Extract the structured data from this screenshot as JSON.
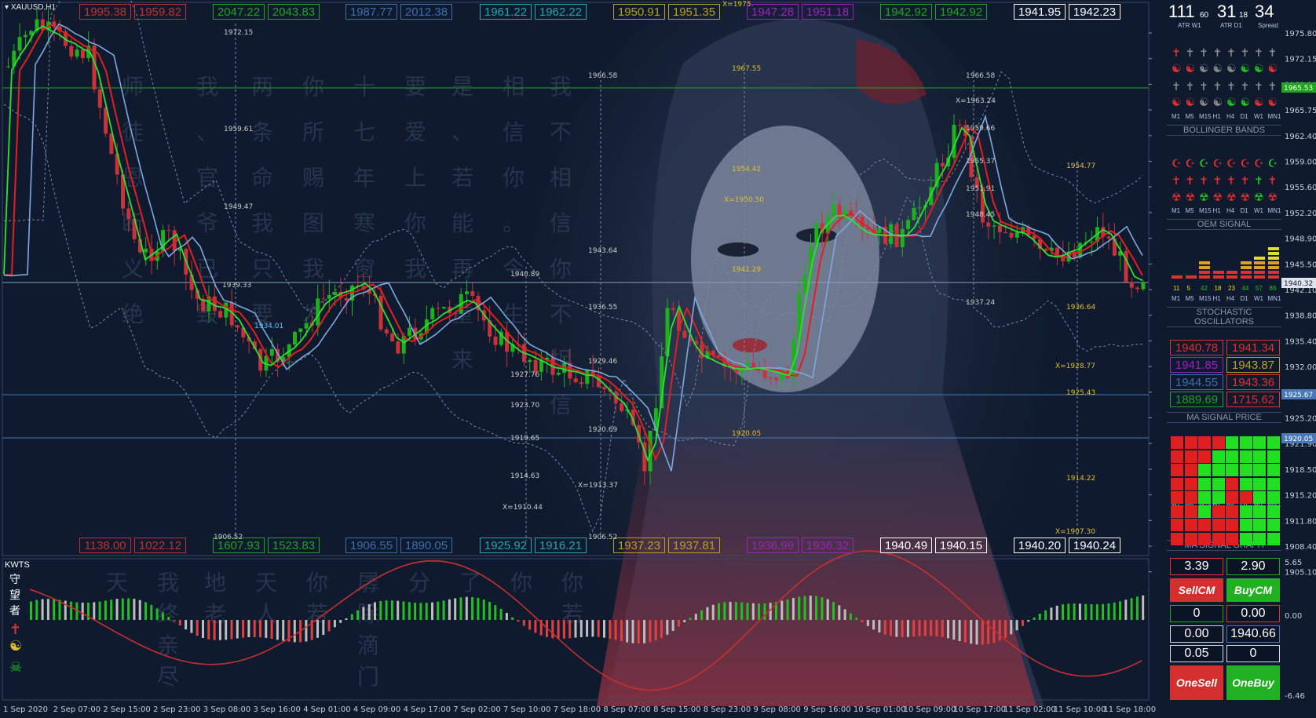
{
  "symbol": "XAUUSD,H1",
  "indicator_name": "KWTS",
  "indicator_cn": [
    "守",
    "望",
    "者"
  ],
  "top_pairs": [
    {
      "a": "1995.38",
      "b": "1959.82",
      "color": "#c0312b"
    },
    {
      "a": "2047.22",
      "b": "2043.83",
      "color": "#21a421"
    },
    {
      "a": "1987.77",
      "b": "2012.38",
      "color": "#3a6fb0"
    },
    {
      "a": "1961.22",
      "b": "1962.22",
      "color": "#20a8b0"
    },
    {
      "a": "1950.91",
      "b": "1951.35",
      "color": "#b8a020"
    },
    {
      "a": "1947.28",
      "b": "1951.18",
      "color": "#a020c0"
    },
    {
      "a": "1942.92",
      "b": "1942.92",
      "color": "#21a421"
    },
    {
      "a": "1941.95",
      "b": "1942.23",
      "color": "#ffffff"
    }
  ],
  "bottom_pairs": [
    {
      "a": "1138.00",
      "b": "1022.12",
      "color": "#c0312b"
    },
    {
      "a": "1607.93",
      "b": "1523.83",
      "color": "#21a421"
    },
    {
      "a": "1906.55",
      "b": "1890.05",
      "color": "#3a6fb0"
    },
    {
      "a": "1925.92",
      "b": "1916.21",
      "color": "#20a8b0"
    },
    {
      "a": "1937.23",
      "b": "1937.81",
      "color": "#b8a020"
    },
    {
      "a": "1936.99",
      "b": "1936.32",
      "color": "#a020c0"
    },
    {
      "a": "1940.49",
      "b": "1940.15",
      "color": "#ffffff"
    },
    {
      "a": "1940.20",
      "b": "1940.24",
      "color": "#ffffff"
    }
  ],
  "info": {
    "atr_w1": "111",
    "atr_w1_small": "60",
    "atr_d1": "31",
    "atr_d1_small": "18",
    "spread": "34",
    "lbl_atr_w1": "ATR W1",
    "lbl_atr_d1": "ATR D1",
    "lbl_spread": "Spread"
  },
  "timeframes": [
    "M1",
    "M5",
    "M15",
    "H1",
    "H4",
    "D1",
    "W1",
    "MN1"
  ],
  "panels": {
    "bollinger": "BOLLINGER BANDS",
    "oem": "OEM   SIGNAL",
    "stochastic": "STOCHASTIC OSCILLATORS",
    "ma_price": "MA SIGNAL PRICE",
    "ma_graph": "MA SIGNAL GRAPH"
  },
  "stoch_values": [
    "11",
    "5",
    "42",
    "18",
    "23",
    "44",
    "57",
    "86"
  ],
  "ma_prices": [
    {
      "v": "1940.78",
      "c": "#e03030"
    },
    {
      "v": "1941.34",
      "c": "#e03030"
    },
    {
      "v": "1941.85",
      "c": "#a020c0"
    },
    {
      "v": "1943.87",
      "c": "#b8a020"
    },
    {
      "v": "1944.55",
      "c": "#3a6fb0"
    },
    {
      "v": "1943.36",
      "c": "#e03030"
    },
    {
      "v": "1889.69",
      "c": "#21a421"
    },
    {
      "v": "1715.62",
      "c": "#e03030"
    }
  ],
  "trade": {
    "sell_val": "3.39",
    "buy_val": "2.90",
    "sell_cm": "SellCM",
    "buy_cm": "BuyCM",
    "f1": "0",
    "f2": "0.00",
    "f3": "0.00",
    "f4": "1940.66",
    "f5": "0.05",
    "f6": "0",
    "one_sell": "OneSell",
    "one_buy": "OneBuy"
  },
  "price_axis": [
    "1975.80",
    "1972.15",
    "1969.10",
    "1965.75",
    "1962.40",
    "1959.00",
    "1955.60",
    "1952.20",
    "1948.90",
    "1945.50",
    "1942.10",
    "1938.80",
    "1935.40",
    "1932.00",
    "1928.60",
    "1925.20",
    "1921.90",
    "1918.50",
    "1915.20",
    "1911.80",
    "1908.40",
    "1905.10"
  ],
  "price_tags": {
    "green": "1965.53",
    "current": "1940.32",
    "blue1": "1925.67",
    "blue2": "1920.05"
  },
  "osc_axis": {
    "top": "5.65",
    "mid": "0.00",
    "bot": "-6.46"
  },
  "time_axis": [
    "1 Sep 2020",
    "2 Sep 07:00",
    "2 Sep 15:00",
    "2 Sep 23:00",
    "3 Sep 08:00",
    "3 Sep 16:00",
    "4 Sep 01:00",
    "4 Sep 09:00",
    "4 Sep 17:00",
    "7 Sep 02:00",
    "7 Sep 10:00",
    "7 Sep 18:00",
    "8 Sep 07:00",
    "8 Sep 15:00",
    "8 Sep 23:00",
    "9 Sep 08:00",
    "9 Sep 16:00",
    "10 Sep 01:00",
    "10 Sep 09:00",
    "10 Sep 17:00",
    "11 Sep 02:00",
    "11 Sep 10:00",
    "11 Sep 18:00"
  ],
  "chart_labels": [
    {
      "t": "1972.15",
      "c": "#cccccc"
    },
    {
      "t": "1959.61",
      "c": "#cccccc"
    },
    {
      "t": "1949.47",
      "c": "#cccccc"
    },
    {
      "t": "1939.33",
      "c": "#cccccc"
    },
    {
      "t": "1934.01",
      "c": "#60c0ff"
    },
    {
      "t": "1906.52",
      "c": "#cccccc"
    },
    {
      "t": "1966.58",
      "c": "#cccccc"
    },
    {
      "t": "1943.64",
      "c": "#cccccc"
    },
    {
      "t": "1936.55",
      "c": "#cccccc"
    },
    {
      "t": "1940.89",
      "c": "#cccccc"
    },
    {
      "t": "1929.46",
      "c": "#cccccc"
    },
    {
      "t": "1927.76",
      "c": "#cccccc"
    },
    {
      "t": "1923.70",
      "c": "#cccccc"
    },
    {
      "t": "1920.69",
      "c": "#cccccc"
    },
    {
      "t": "1919.65",
      "c": "#cccccc"
    },
    {
      "t": "1914.63",
      "c": "#cccccc"
    },
    {
      "t": "X=1913.37",
      "c": "#cccccc"
    },
    {
      "t": "X=1910.44",
      "c": "#cccccc"
    },
    {
      "t": "1906.52",
      "c": "#cccccc"
    },
    {
      "t": "1967.55",
      "c": "#e0c030"
    },
    {
      "t": "1954.42",
      "c": "#e0c030"
    },
    {
      "t": "X=1950.50",
      "c": "#e0c030"
    },
    {
      "t": "1941.29",
      "c": "#e0c030"
    },
    {
      "t": "1920.05",
      "c": "#e0c030"
    },
    {
      "t": "X=1975.",
      "c": "#e0c030"
    },
    {
      "t": "1966.58",
      "c": "#cccccc"
    },
    {
      "t": "X=1963.24",
      "c": "#cccccc"
    },
    {
      "t": "1959.66",
      "c": "#cccccc"
    },
    {
      "t": "1955.37",
      "c": "#cccccc"
    },
    {
      "t": "1951.91",
      "c": "#cccccc"
    },
    {
      "t": "1948.45",
      "c": "#cccccc"
    },
    {
      "t": "1937.24",
      "c": "#cccccc"
    },
    {
      "t": "1954.77",
      "c": "#e0c030"
    },
    {
      "t": "1936.64",
      "c": "#e0c030"
    },
    {
      "t": "X=1928.77",
      "c": "#e0c030"
    },
    {
      "t": "1925.43",
      "c": "#e0c030"
    },
    {
      "t": "1914.22",
      "c": "#e0c030"
    },
    {
      "t": "X=1907.30",
      "c": "#e0c030"
    }
  ]
}
